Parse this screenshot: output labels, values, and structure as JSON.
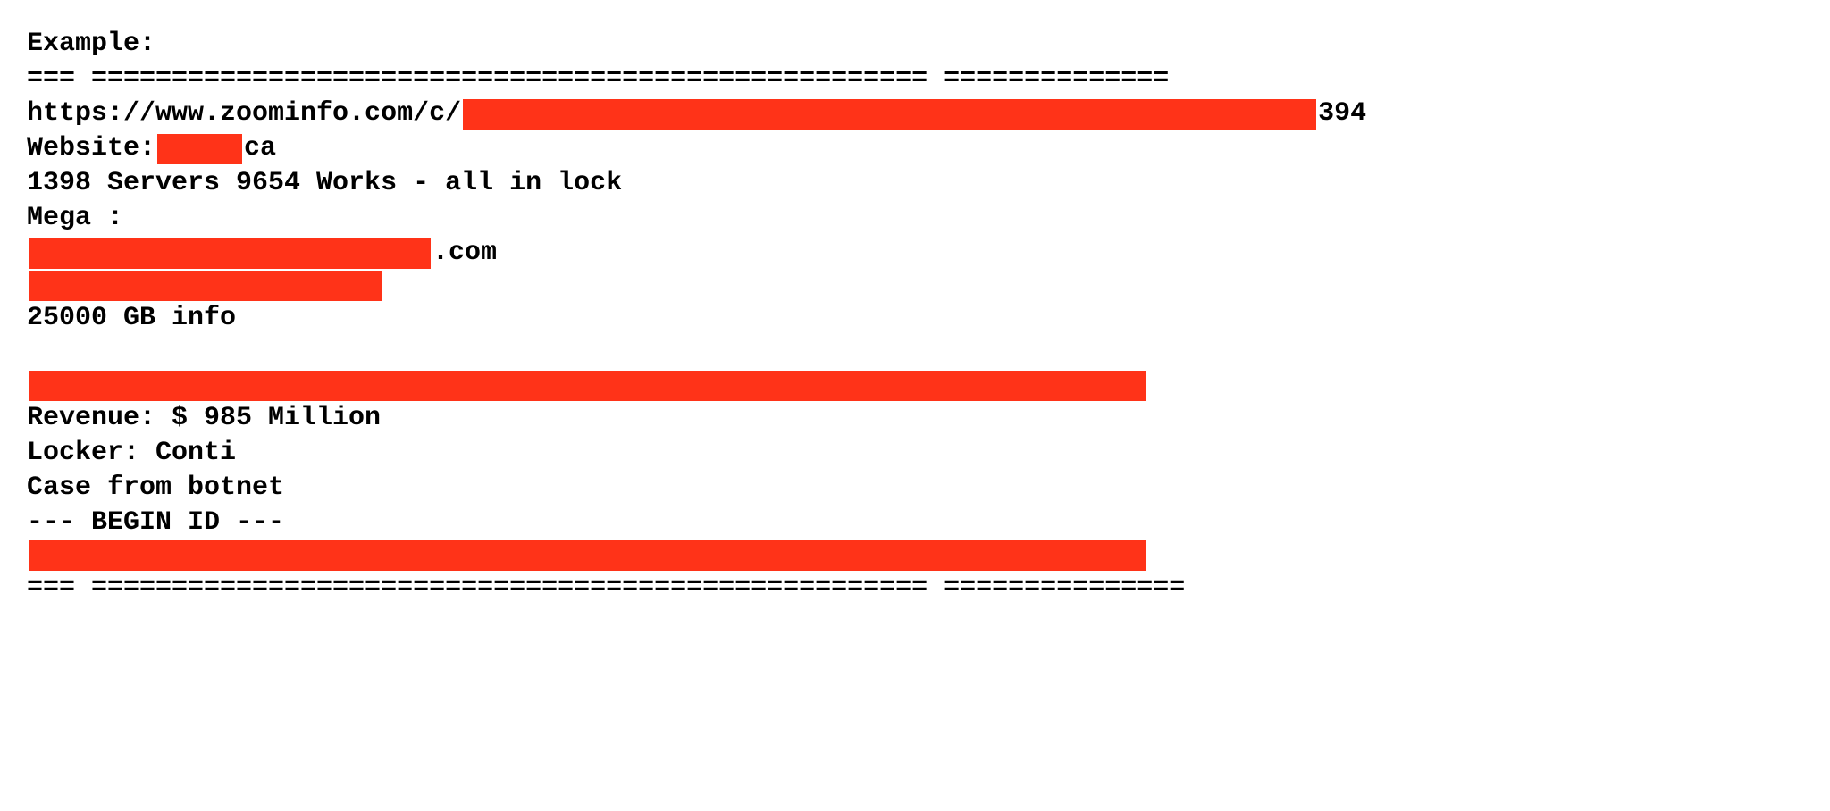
{
  "header": "Example:",
  "sep_line": "=== ==================================================== ==============",
  "url_prefix": "https://www.zoominfo.com/c/",
  "url_suffix": "394",
  "website_label": "Website: ",
  "website_tld": "ca",
  "servers_line": "1398 Servers 9654 Works - all in lock",
  "mega_label": "Mega :",
  "mega_com": ".com",
  "gb_line": "25000 GB info",
  "revenue_line": "Revenue: $ 985 Million",
  "locker_line": "Locker: Conti",
  "case_line": "Case from botnet",
  "begin_id": "--- BEGIN ID ---",
  "footer_sep": "=== ==================================================== ==============="
}
